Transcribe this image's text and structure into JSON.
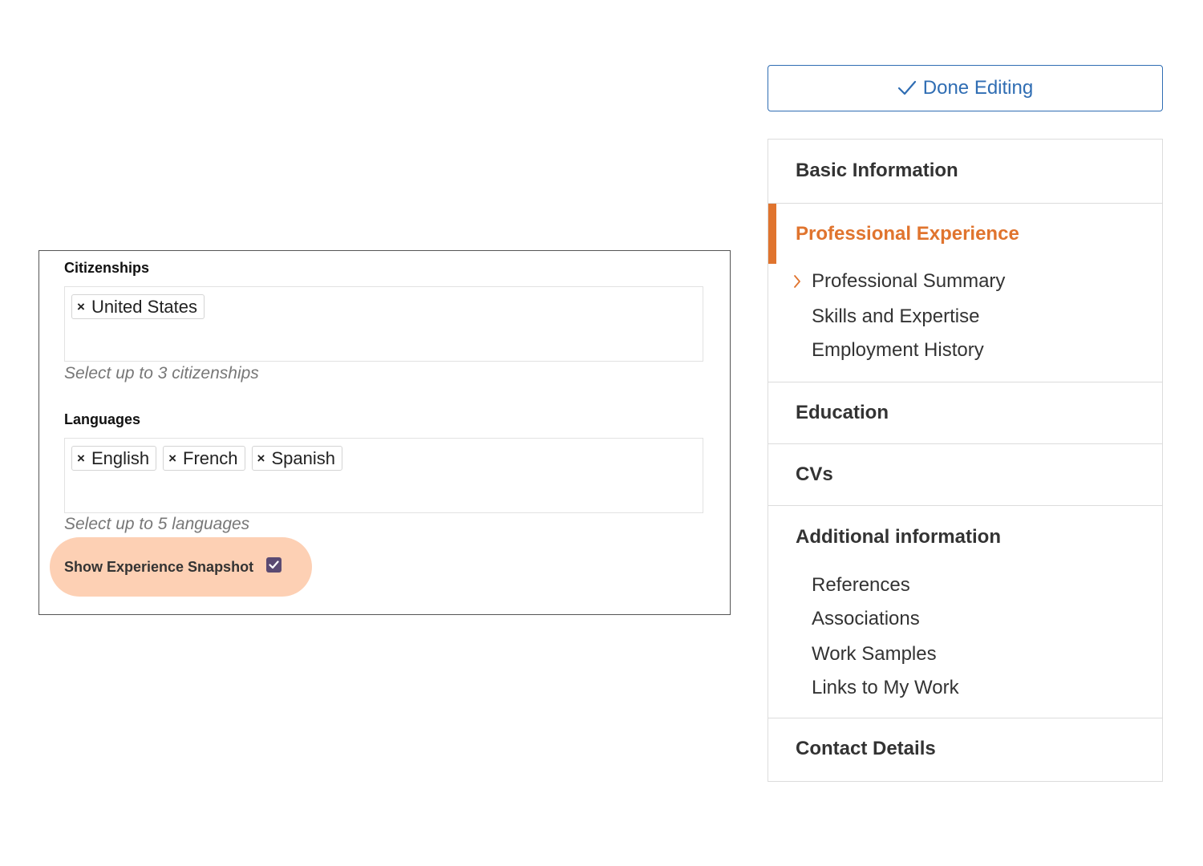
{
  "toolbar": {
    "done_label": "Done Editing",
    "done_icon": "checkmark-icon"
  },
  "form": {
    "citizenships": {
      "label": "Citizenships",
      "tags": [
        "United States"
      ],
      "help": "Select up to 3 citizenships"
    },
    "languages": {
      "label": "Languages",
      "tags": [
        "English",
        "French",
        "Spanish"
      ],
      "help": "Select up to 5 languages"
    },
    "snapshot": {
      "label": "Show Experience Snapshot",
      "checked": true,
      "highlight_color": "#fdd0b4"
    }
  },
  "nav": {
    "sections": [
      {
        "label": "Basic Information",
        "active": false
      },
      {
        "label": "Professional Experience",
        "active": true,
        "items": [
          "Professional Summary",
          "Skills and Expertise",
          "Employment History"
        ],
        "current_item": "Professional Summary"
      },
      {
        "label": "Education",
        "active": false
      },
      {
        "label": "CVs",
        "active": false
      },
      {
        "label": "Additional information",
        "active": false,
        "items": [
          "References",
          "Associations",
          "Work Samples",
          "Links to My Work"
        ]
      },
      {
        "label": "Contact Details",
        "active": false
      }
    ]
  },
  "colors": {
    "accent": "#e0742e",
    "primary": "#2f6db3",
    "checkbox": "#5a4a72"
  }
}
